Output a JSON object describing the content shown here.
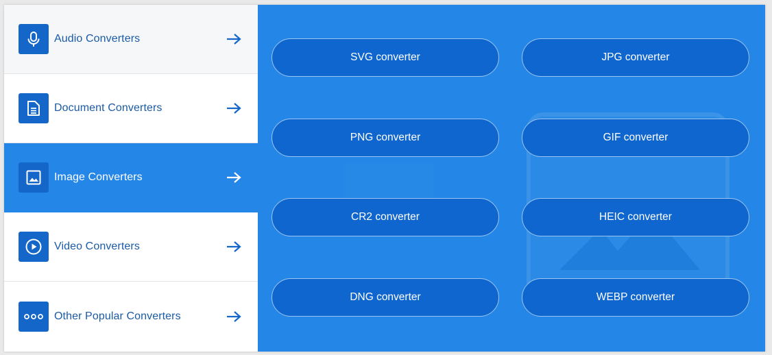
{
  "sidebar": {
    "items": [
      {
        "label": "Audio Converters",
        "icon": "microphone-icon"
      },
      {
        "label": "Document Converters",
        "icon": "document-icon"
      },
      {
        "label": "Image Converters",
        "icon": "image-icon",
        "active": true
      },
      {
        "label": "Video Converters",
        "icon": "play-icon"
      },
      {
        "label": "Other Popular Converters",
        "icon": "more-dots-icon"
      }
    ],
    "arrow_icon": "arrow-right-icon"
  },
  "converters": [
    {
      "label": "SVG converter"
    },
    {
      "label": "JPG converter"
    },
    {
      "label": "PNG converter"
    },
    {
      "label": "GIF converter"
    },
    {
      "label": "CR2 converter"
    },
    {
      "label": "HEIC converter"
    },
    {
      "label": "DNG converter"
    },
    {
      "label": "WEBP converter"
    }
  ],
  "colors": {
    "accent": "#2486e6",
    "icon_bg": "#1466c8",
    "button_bg": "#0f66cf",
    "label_text": "#1a5aa6"
  }
}
